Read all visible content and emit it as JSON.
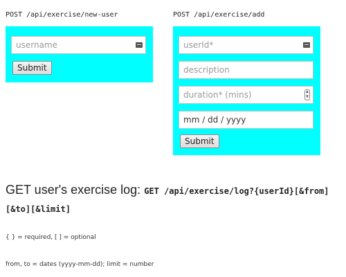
{
  "new_user_form": {
    "route": "POST /api/exercise/new-user",
    "username_placeholder": "username",
    "submit_label": "Submit"
  },
  "add_exercise_form": {
    "route": "POST /api/exercise/add",
    "userid_placeholder": "userId*",
    "description_placeholder": "description",
    "duration_placeholder": "duration* (mins)",
    "date_value": "mm / dd / yyyy",
    "submit_label": "Submit"
  },
  "log_section": {
    "heading_text": "GET user's exercise log: ",
    "heading_code": "GET /api/exercise/log?{userId}[&from][&to][&limit]",
    "note_required": "{ } = required, [ ] = optional",
    "note_params": "from, to = dates (yyyy-mm-dd); limit = number"
  },
  "colors": {
    "panel_bg": "#00ffff"
  },
  "icons": {
    "autofill": "keyboard-icon",
    "number_spinner": "spinner-icon"
  }
}
